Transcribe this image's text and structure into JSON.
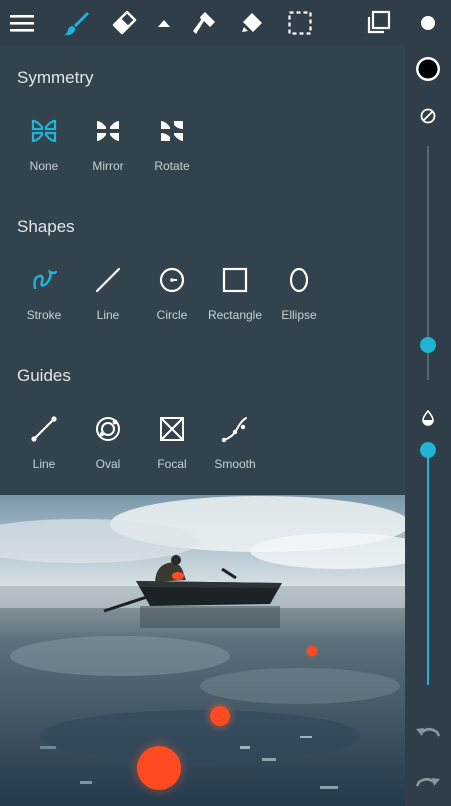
{
  "toolbar": {
    "icons": [
      "menu-icon",
      "brush-icon",
      "eraser-icon",
      "caret-up-icon",
      "smudge-icon",
      "fill-icon",
      "selection-icon",
      "layers-icon",
      "brush-size-dot-icon"
    ]
  },
  "sidebar": {
    "icons": [
      "color-swatch-icon",
      "no-brush-icon",
      "opacity-drop-icon",
      "undo-icon",
      "redo-icon"
    ],
    "current_color": "#000000",
    "size_level": 0.15,
    "opacity_level": 1.0
  },
  "panel": {
    "symmetry": {
      "title": "Symmetry",
      "items": [
        {
          "label": "None",
          "icon": "symmetry-none-icon",
          "active": true
        },
        {
          "label": "Mirror",
          "icon": "symmetry-mirror-icon",
          "active": false
        },
        {
          "label": "Rotate",
          "icon": "symmetry-rotate-icon",
          "active": false
        }
      ]
    },
    "shapes": {
      "title": "Shapes",
      "items": [
        {
          "label": "Stroke",
          "icon": "stroke-icon",
          "active": true
        },
        {
          "label": "Line",
          "icon": "line-icon",
          "active": false
        },
        {
          "label": "Circle",
          "icon": "circle-icon",
          "active": false
        },
        {
          "label": "Rectangle",
          "icon": "rectangle-icon",
          "active": false
        },
        {
          "label": "Ellipse",
          "icon": "ellipse-icon",
          "active": false
        }
      ]
    },
    "guides": {
      "title": "Guides",
      "items": [
        {
          "label": "Line",
          "icon": "guide-line-icon",
          "active": false
        },
        {
          "label": "Oval",
          "icon": "guide-oval-icon",
          "active": false
        },
        {
          "label": "Focal",
          "icon": "guide-focal-icon",
          "active": false
        },
        {
          "label": "Smooth",
          "icon": "guide-smooth-icon",
          "active": false
        }
      ]
    }
  },
  "colors": {
    "accent": "#20b4d6",
    "panel_bg": "#33434e",
    "toolbar_bg": "#2f3e48"
  }
}
